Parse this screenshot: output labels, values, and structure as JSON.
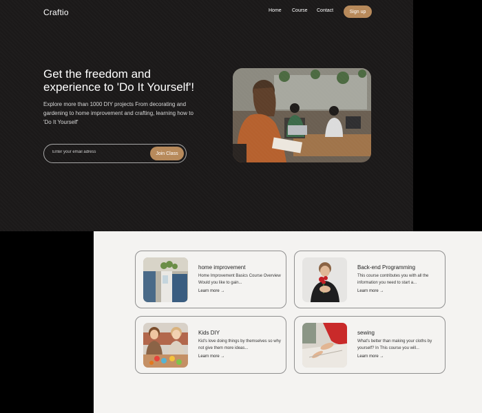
{
  "header": {
    "logo": "Craftio",
    "nav": {
      "home": "Home",
      "course": "Course",
      "contact": "Contact"
    },
    "signup_label": "Sign up"
  },
  "hero": {
    "headline": "Get the freedom and experience to 'Do It Yourself'!",
    "subtext": "Explore more than 1000 DIY projects From decorating and gardening to home improvement and crafting, learning how to 'Do It Yourself'",
    "email_placeholder": "Enter your email adress",
    "join_label": "Join Class"
  },
  "courses": [
    {
      "title": "home improvement",
      "desc": "Home Improvement Basics Course Overview Would you like to gain...",
      "link": "Learn more →"
    },
    {
      "title": "Back-end Programming",
      "desc": "This course contributes you with all the information you need to start a...",
      "link": "Learn more →"
    },
    {
      "title": "Kids DIY",
      "desc": "Kid's love doing things by themselves so why not give them more ideas...",
      "link": "Learn more →"
    },
    {
      "title": "sewing",
      "desc": "What's better than making your cloths by yourself? In This course you will...",
      "link": "Learn more →"
    }
  ],
  "colors": {
    "accent": "#b7895a",
    "hero_bg": "#1b1919",
    "section_bg": "#f4f3f1"
  }
}
